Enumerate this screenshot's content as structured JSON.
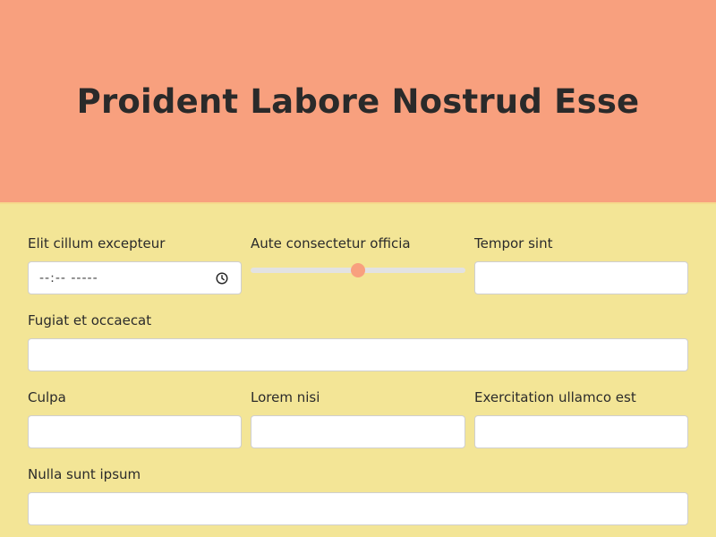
{
  "page": {
    "title": "Proident Labore Nostrud Esse"
  },
  "colors": {
    "header_bg": "#f8a07e",
    "form_bg": "#f3e596",
    "accent": "#f8a07e"
  },
  "form": {
    "row1": {
      "time": {
        "label": "Elit cillum excepteur",
        "value": "--:-- -----",
        "icon": "clock-icon"
      },
      "slider": {
        "label": "Aute consectetur officia",
        "value": 50,
        "min": 0,
        "max": 100
      },
      "text": {
        "label": "Tempor sint",
        "value": ""
      }
    },
    "row2": {
      "text": {
        "label": "Fugiat et occaecat",
        "value": ""
      }
    },
    "row3": {
      "a": {
        "label": "Culpa",
        "value": ""
      },
      "b": {
        "label": "Lorem nisi",
        "value": ""
      },
      "c": {
        "label": "Exercitation ullamco est",
        "value": ""
      }
    },
    "row4": {
      "text": {
        "label": "Nulla sunt ipsum",
        "value": ""
      }
    }
  }
}
